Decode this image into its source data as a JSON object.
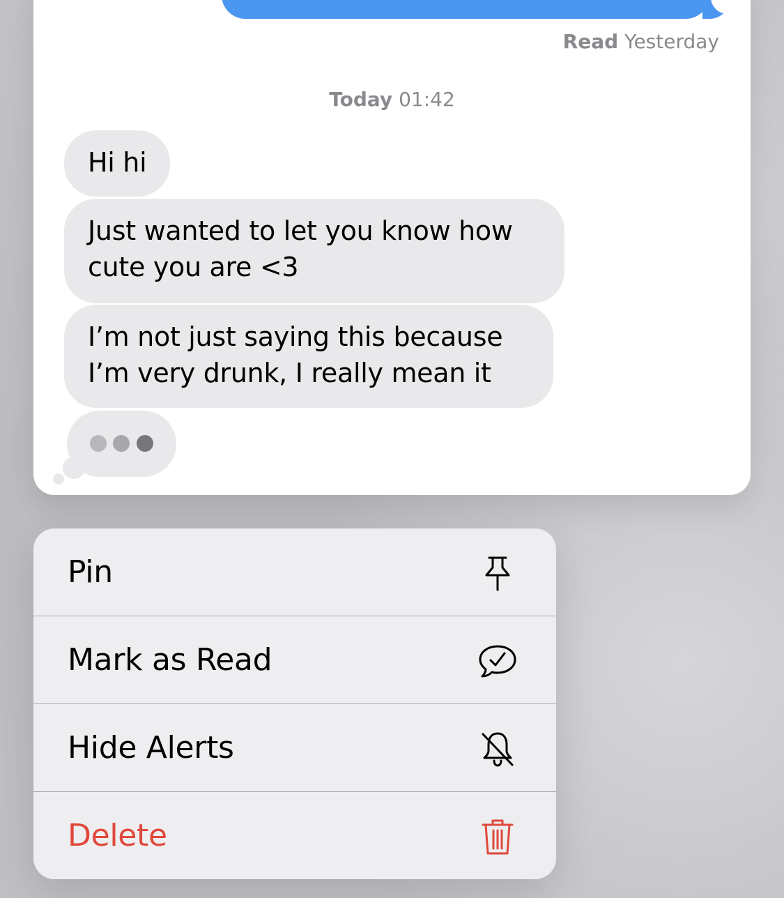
{
  "conversation": {
    "read_receipt": {
      "status": "Read",
      "time": "Yesterday"
    },
    "timestamp": {
      "day": "Today",
      "time": "01:42"
    },
    "messages": [
      {
        "text": "Hi hi"
      },
      {
        "text": "Just wanted to let you know how cute you are <3"
      },
      {
        "text": "I’m not just saying this because I’m very drunk, I really mean it"
      }
    ],
    "typing_indicator": true
  },
  "context_menu": {
    "items": [
      {
        "label": "Pin",
        "icon": "pin-icon"
      },
      {
        "label": "Mark as Read",
        "icon": "message-check-icon"
      },
      {
        "label": "Hide Alerts",
        "icon": "bell-slash-icon"
      },
      {
        "label": "Delete",
        "icon": "trash-icon",
        "destructive": true
      }
    ]
  },
  "colors": {
    "sent_bubble": "#4a96f0",
    "received_bubble": "#e9e9eb",
    "destructive": "#e0483c",
    "meta_text": "#8a8a8e"
  }
}
